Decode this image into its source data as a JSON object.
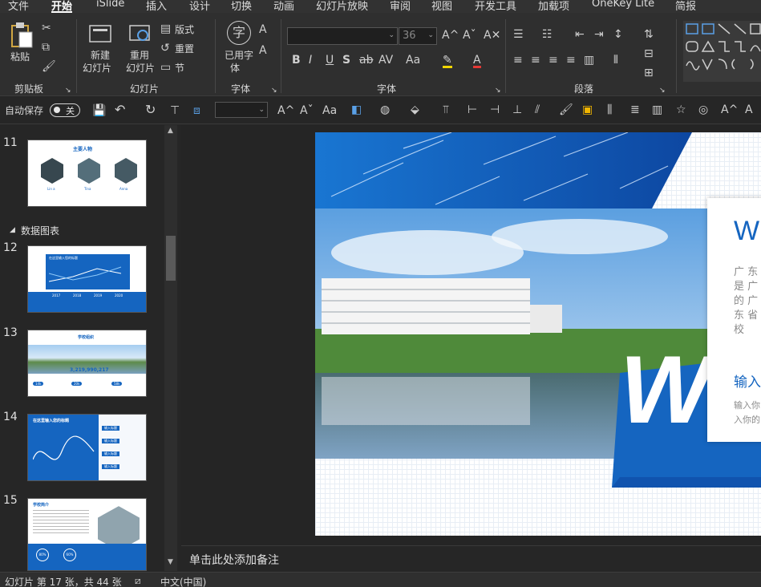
{
  "menu": {
    "tabs": [
      "文件",
      "开始",
      "iSlide",
      "插入",
      "设计",
      "切换",
      "动画",
      "幻灯片放映",
      "审阅",
      "视图",
      "开发工具",
      "加载项",
      "OneKey Lite",
      "简报"
    ],
    "active": "开始"
  },
  "ribbon": {
    "clipboard": {
      "paste": "粘贴",
      "group": "剪贴板"
    },
    "slides": {
      "new_line1": "新建",
      "new_line2": "幻灯片",
      "reuse_line1": "重用",
      "reuse_line2": "幻灯片",
      "layout": "版式",
      "reset": "重置",
      "section": "节",
      "group": "幻灯片"
    },
    "fontgroup1": {
      "used_line1": "已用字",
      "used_line2": "体",
      "group": "字体"
    },
    "font": {
      "size": "36",
      "group": "字体"
    },
    "paragraph": {
      "group": "段落"
    }
  },
  "qat": {
    "autosave_label": "自动保存",
    "autosave_state": "关"
  },
  "thumbs": {
    "section_title": "数据图表",
    "slides": [
      {
        "num": "11",
        "title": "主要人物",
        "names": [
          "Lin a",
          "Tina",
          "Anna"
        ]
      },
      {
        "num": "12",
        "title": "在这里输入您的标题",
        "years": [
          "2017",
          "2018",
          "2019",
          "2020"
        ]
      },
      {
        "num": "13",
        "title": "学校组织",
        "number": "3,219,990,217",
        "badges": [
          "14k",
          "20k",
          "58k"
        ]
      },
      {
        "num": "14",
        "title": "在这里输入您的标题",
        "items": [
          "输入标题",
          "输入标题",
          "输入标题",
          "输入标题"
        ]
      },
      {
        "num": "15",
        "title": "学校简介",
        "circles": [
          "80%",
          "60%"
        ]
      }
    ]
  },
  "slide": {
    "heading_partial": "WH",
    "body_lines": [
      "广 东",
      "是 广",
      "的 广",
      "东 省",
      "校"
    ],
    "sub_heading": "输入",
    "sub_body": [
      "输入你",
      "入你的"
    ],
    "big_letter": "W"
  },
  "notes": {
    "placeholder": "单击此处添加备注"
  },
  "status": {
    "slide_info": "幻灯片 第 17 张，共 44 张",
    "language": "中文(中国)"
  },
  "colors": {
    "accent_blue": "#1565c0",
    "dark_blue": "#0d47a1",
    "ribbon_bg": "#2f2f2f"
  }
}
